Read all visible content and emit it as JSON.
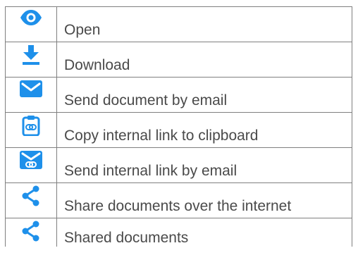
{
  "accent_color": "#1e90ea",
  "actions": [
    {
      "icon": "eye-icon",
      "label": "Open"
    },
    {
      "icon": "download-icon",
      "label": "Download"
    },
    {
      "icon": "envelope-icon",
      "label": "Send document by email"
    },
    {
      "icon": "clipboard-link-icon",
      "label": "Copy internal link to clipboard"
    },
    {
      "icon": "envelope-link-icon",
      "label": "Send internal link by email"
    },
    {
      "icon": "share-icon",
      "label": "Share documents over the internet"
    },
    {
      "icon": "share-icon",
      "label": "Shared documents"
    }
  ]
}
